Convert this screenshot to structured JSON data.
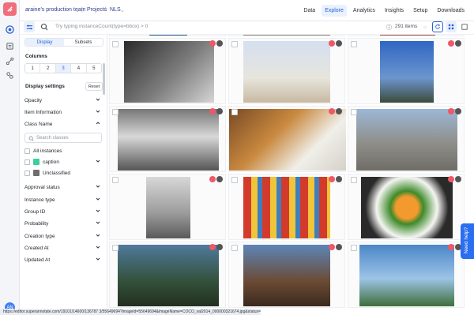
{
  "breadcrumb": {
    "team": "araine's production team",
    "projects": "Projects",
    "project": "NLS"
  },
  "nav_tabs": [
    "Data",
    "Explore",
    "Analytics",
    "Insights",
    "Setup",
    "Downloads"
  ],
  "toolbar": {
    "query_placeholder": "Try typing instanceCount(type=bbox) > 0",
    "items_count": "291 items"
  },
  "panel": {
    "seg_display": "Display",
    "seg_subsets": "Subsets",
    "columns_label": "Columns",
    "columns": [
      "1",
      "2",
      "3",
      "4",
      "5"
    ],
    "display_settings": "Display settings",
    "reset": "Reset",
    "opacity": "Opacity",
    "item_information": "Item Information",
    "class_name": "Class Name",
    "search_classes": "Search classes",
    "all_instances": "All instances",
    "class_caption": "caption",
    "class_unclassified": "Unclassified",
    "approval_status": "Approval status",
    "instance_type": "Instance type",
    "group_id": "Group ID",
    "probability": "Probability",
    "creation_type": "Creation type",
    "created_at": "Created At",
    "updated_at": "Updated At"
  },
  "avatar": "AN",
  "status_url": "https://editor.superannotate.com/19101/14600/136787 3/55649694?imageId=55649694&imageName=COCO_val2014_000000321674.jpg&status=2",
  "help": "Need help?",
  "colors": {
    "caption_swatch": "#3bcf9e",
    "unclassified_swatch": "#6e6e6e",
    "accent": "#2a62d3"
  }
}
